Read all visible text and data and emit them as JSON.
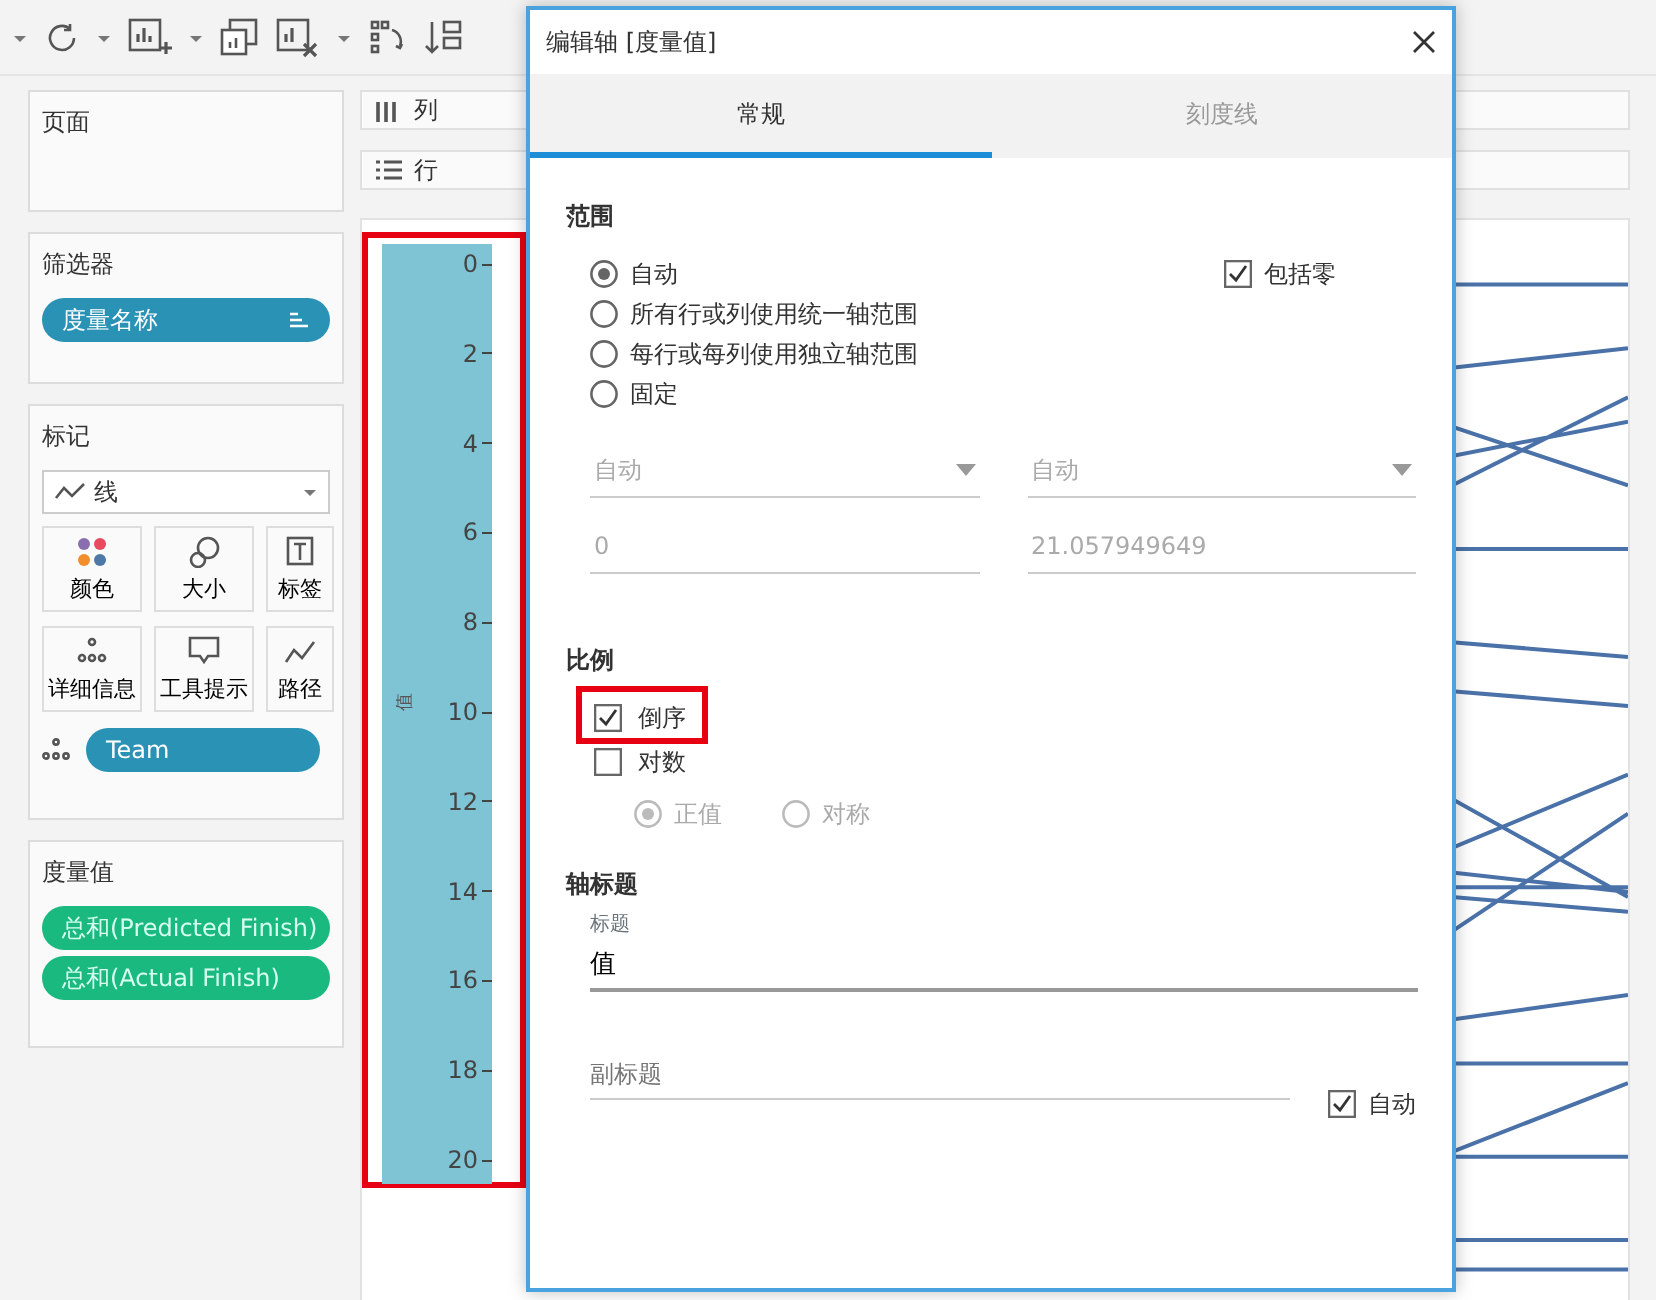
{
  "left_panel": {
    "pages": {
      "title": "页面"
    },
    "filters": {
      "title": "筛选器",
      "pills": [
        {
          "label": "度量名称"
        }
      ]
    },
    "marks": {
      "title": "标记",
      "mark_type": "线",
      "buttons": [
        {
          "label": "颜色",
          "kind": "color"
        },
        {
          "label": "大小",
          "kind": "size"
        },
        {
          "label": "标签",
          "kind": "label"
        },
        {
          "label": "详细信息",
          "kind": "detail"
        },
        {
          "label": "工具提示",
          "kind": "tooltip"
        },
        {
          "label": "路径",
          "kind": "path"
        }
      ],
      "fields": [
        {
          "label": "Team"
        }
      ]
    },
    "measure_values": {
      "title": "度量值",
      "pills": [
        {
          "label": "总和(Predicted Finish)"
        },
        {
          "label": "总和(Actual Finish)"
        }
      ]
    }
  },
  "shelves": [
    {
      "label": "列",
      "kind": "columns"
    },
    {
      "label": "行",
      "kind": "rows"
    }
  ],
  "axis": {
    "title": "值",
    "ticks": [
      "0",
      "2",
      "4",
      "6",
      "8",
      "10",
      "12",
      "14",
      "16",
      "18",
      "20"
    ],
    "highlighted": true
  },
  "dialog": {
    "title": "编辑轴 [度量值]",
    "tabs": [
      {
        "label": "常规",
        "selected": true
      },
      {
        "label": "刻度线",
        "selected": false
      }
    ],
    "range": {
      "title": "范围",
      "options": [
        {
          "label": "自动",
          "selected": true
        },
        {
          "label": "所有行或列使用统一轴范围",
          "selected": false
        },
        {
          "label": "每行或每列使用独立轴范围",
          "selected": false
        },
        {
          "label": "固定",
          "selected": false
        }
      ],
      "include_zero": {
        "label": "包括零",
        "checked": true
      },
      "dropdowns": [
        {
          "value": "自动",
          "disabled": true
        },
        {
          "value": "自动",
          "disabled": true
        }
      ],
      "fields": [
        {
          "value": "0",
          "disabled": true
        },
        {
          "value": "21.057949649",
          "disabled": true
        }
      ]
    },
    "scale": {
      "title": "比例",
      "checkboxes": [
        {
          "label": "倒序",
          "checked": true,
          "highlighted": true
        },
        {
          "label": "对数",
          "checked": false,
          "highlighted": false
        }
      ],
      "log_options": [
        {
          "label": "正值",
          "selected": true,
          "disabled": true
        },
        {
          "label": "对称",
          "selected": false,
          "disabled": true
        }
      ]
    },
    "axis_titles": {
      "title": "轴标题",
      "title_field": {
        "label": "标题",
        "value": "值"
      },
      "subtitle_field": {
        "placeholder": "副标题"
      },
      "auto": {
        "label": "自动",
        "checked": true
      }
    }
  }
}
